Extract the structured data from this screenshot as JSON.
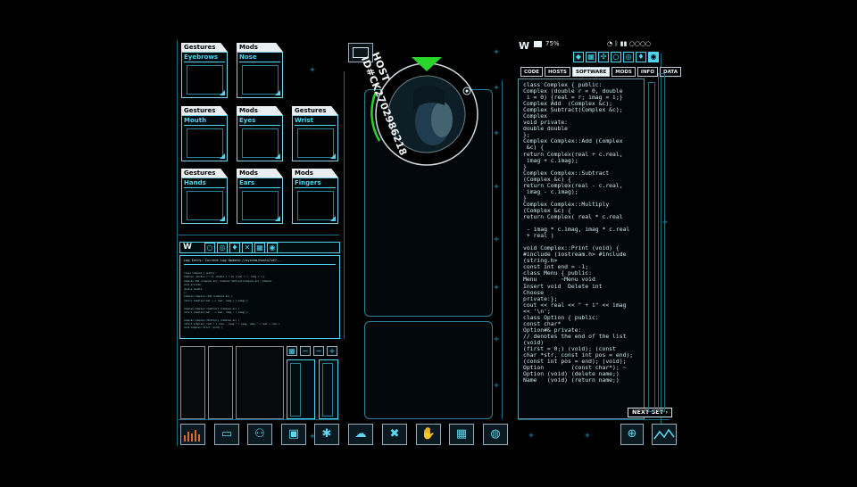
{
  "cards": [
    {
      "category": "Gestures",
      "name": "Eyebrows"
    },
    {
      "category": "Mods",
      "name": "Nose"
    },
    {
      "category": "Gestures",
      "name": "Mouth"
    },
    {
      "category": "Mods",
      "name": "Eyes"
    },
    {
      "category": "Gestures",
      "name": "Wrist"
    },
    {
      "category": "Gestures",
      "name": "Hands"
    },
    {
      "category": "Mods",
      "name": "Ears"
    },
    {
      "category": "Mods",
      "name": "Fingers"
    }
  ],
  "host": {
    "label": "HOST ID#CK2702986218"
  },
  "status": {
    "logo": "W",
    "battery": "75%"
  },
  "code_panel": {
    "tabs": [
      "CODE",
      "HOSTS",
      "SOFTWARE",
      "MODS",
      "INFO",
      "DATA"
    ],
    "active_tab": "SOFTWARE",
    "next_button": "NEXT SET ›",
    "lines": [
      "class Complex { public:",
      "Complex (double r = 0, double",
      " i = 0) {real = r; imag = i;}",
      "Complex Add  (Complex &c);",
      "Complex Subtract(Complex &c);",
      "Complex",
      "void private:",
      "double double",
      "};",
      "Complex Complex::Add (Complex",
      " &c) {",
      "return Complex(real + c.real,",
      " imag + c.imag);",
      "}",
      "Complex Complex::Subtract",
      "(Complex &c) {",
      "return Complex(real - c.real,",
      " imag - c.imag);",
      "}",
      "Complex Complex::Multiply",
      "(Complex &c) {",
      "return Complex( real * c.real",
      "",
      " - imag * c.imag, imag * c.real",
      " + real )",
      "",
      "void Complex::Print (void) {",
      "#include (iostream.h> #include",
      "(string.h>",
      "const int end = -1;",
      "class Menu { public:",
      "Menu       ~Menu void",
      "Insert void  Delete int",
      "Choose",
      "private:};",
      "cout << real << \" + i\" << imag",
      "<< '\\n';",
      "class Option { public:",
      "const char*",
      "Option#& private:",
      "// denotes the end of the list",
      "(void)",
      "(first = 0;) (void); (const",
      "char *str, const int pos = end);",
      "(const int pos = end); (void);",
      "Option        (const char*); ~",
      "Option (void) (delete name;)",
      "Name   (void) (return name;)"
    ]
  },
  "mini_panel": {
    "logo": "W",
    "header": "Log Entry: Current Log Update://system/hosts/v07...",
    "lines": [
      "class Complex { public:",
      "Complex (double r = 0, double i = 0) {real = r; imag = i;}",
      "Complex Add (Complex &c); Complex Subtract(Complex &c); Complex",
      "void private:",
      "double double",
      "};",
      "Complex Complex::Add (Complex &c) {",
      "return Complex(real + c.real, imag + c.imag);}",
      "",
      "Complex Complex::Subtract (Complex &c) {",
      "return Complex(real - c.real, imag - c.imag);}",
      "",
      "Complex Complex::Multiply (Complex &c) {",
      "return Complex( real * c.real - imag * c.imag, imag * c.real + real )",
      "void Complex::Print (void) {"
    ]
  },
  "dock": [
    "chart-icon",
    "monitor-icon",
    "person-network-icon",
    "window-icon",
    "body-icon",
    "cloud-icon",
    "tools-icon",
    "hand-icon",
    "grid-icon",
    "fingerprint-icon"
  ],
  "colors": {
    "accent": "#4ed4ee",
    "line": "#1a6e82",
    "green": "#2bd62b",
    "background": "#000000"
  }
}
